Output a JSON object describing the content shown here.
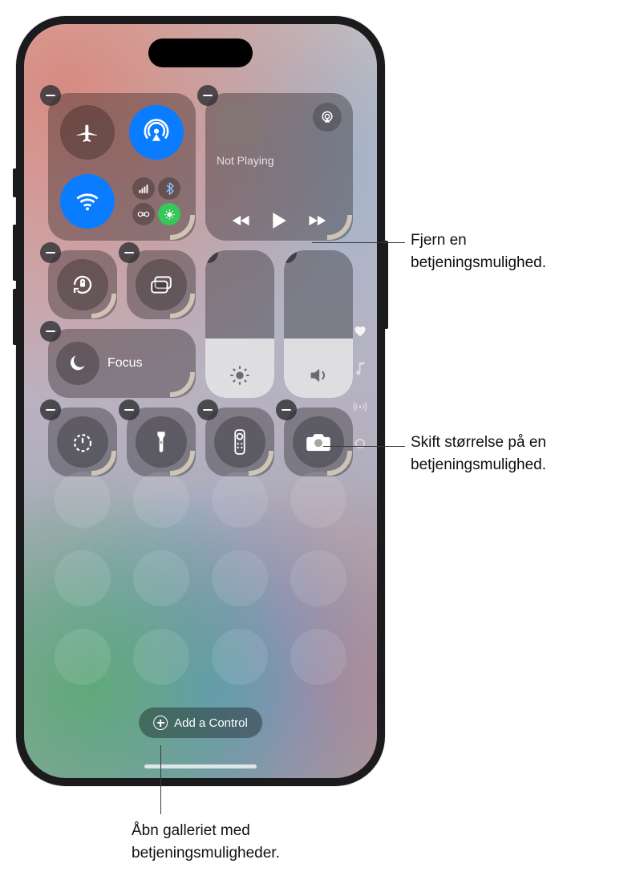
{
  "colors": {
    "accent_blue": "#0a7cff",
    "accent_green": "#34c759",
    "white": "#ffffff",
    "tile_bg": "rgba(0,0,0,0.30)"
  },
  "connectivity": {
    "airplane": {
      "name": "airplane-icon",
      "active": false
    },
    "airdrop": {
      "name": "airdrop-icon",
      "active": true
    },
    "wifi": {
      "name": "wifi-icon",
      "active": true
    },
    "mini": {
      "cellular": {
        "name": "cellular-icon",
        "active": false
      },
      "bluetooth": {
        "name": "bluetooth-icon",
        "active": true
      },
      "link": {
        "name": "personal-hotspot-icon",
        "active": false
      },
      "satellite": {
        "name": "satellite-icon",
        "active": true
      }
    }
  },
  "now_playing": {
    "title": "Not Playing",
    "airplay_icon": "airplay-icon",
    "prev_icon": "backward-icon",
    "play_icon": "play-icon",
    "next_icon": "forward-icon"
  },
  "focus": {
    "label": "Focus",
    "icon": "moon-icon"
  },
  "sliders": {
    "brightness": {
      "icon": "sun-icon",
      "level_pct": 40
    },
    "volume": {
      "icon": "speaker-icon",
      "level_pct": 40
    }
  },
  "controls_row": [
    {
      "key": "orientation-lock",
      "icon": "orientation-lock-icon"
    },
    {
      "key": "screen-mirroring",
      "icon": "screen-mirroring-icon"
    }
  ],
  "bottom_row": [
    {
      "key": "timer",
      "icon": "timer-icon"
    },
    {
      "key": "flashlight",
      "icon": "flashlight-icon"
    },
    {
      "key": "remote",
      "icon": "remote-icon"
    },
    {
      "key": "camera",
      "icon": "camera-icon"
    }
  ],
  "sidebar_pager": [
    {
      "icon": "heart-icon"
    },
    {
      "icon": "music-note-icon"
    },
    {
      "icon": "antenna-icon"
    },
    {
      "icon": "circle-icon"
    }
  ],
  "add_control": {
    "label": "Add a Control",
    "icon": "plus-circle-icon"
  },
  "callouts": {
    "remove": "Fjern en\nbetjeningsmulighed.",
    "resize": "Skift størrelse på en\nbetjeningsmulighed.",
    "gallery": "Åbn galleriet med\nbetjeningsmuligheder."
  }
}
